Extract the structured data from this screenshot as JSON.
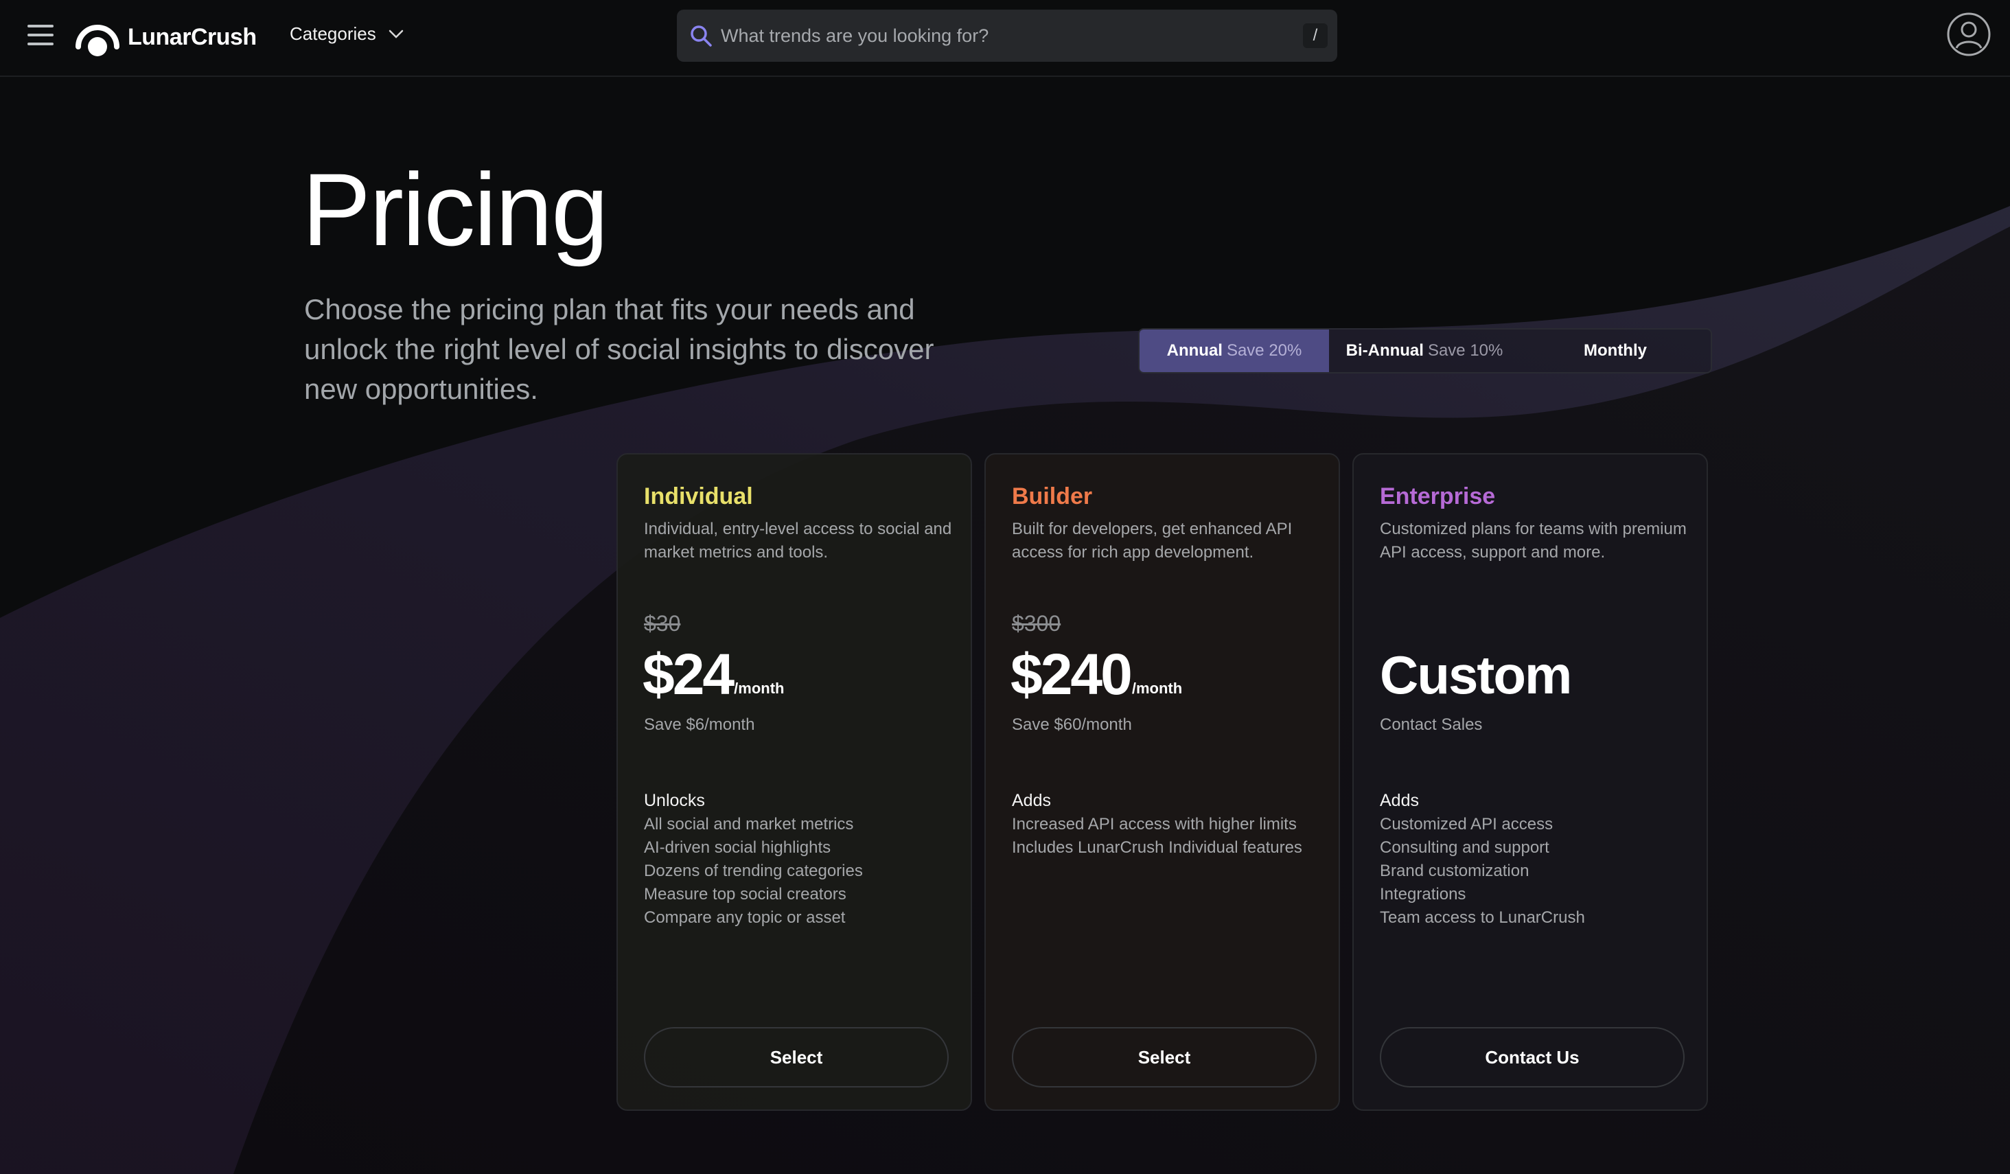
{
  "header": {
    "brand": "LunarCrush",
    "categories_label": "Categories",
    "search_placeholder": "What trends are you looking for?",
    "search_shortcut": "/"
  },
  "hero": {
    "title": "Pricing",
    "subtitle": "Choose the pricing plan that fits your needs and unlock the right level of social insights to discover new opportunities."
  },
  "billing": {
    "selected": "Annual",
    "options": [
      {
        "label": "Annual",
        "save": "Save 20%"
      },
      {
        "label": "Bi-Annual",
        "save": "Save 10%"
      },
      {
        "label": "Monthly",
        "save": ""
      }
    ]
  },
  "plans": [
    {
      "name": "Individual",
      "color": "#e8e06a",
      "description": "Individual, entry-level access to social and market metrics and tools.",
      "old_price": "$30",
      "price": "$24",
      "period": "/month",
      "note": "Save $6/month",
      "features_title": "Unlocks",
      "features": [
        "All social and market metrics",
        "AI-driven social highlights",
        "Dozens of trending categories",
        "Measure top social creators",
        "Compare any topic or asset"
      ],
      "button": "Select"
    },
    {
      "name": "Builder",
      "color": "#ef7a4a",
      "description": "Built for developers, get enhanced API access for rich app development.",
      "old_price": "$300",
      "price": "$240",
      "period": "/month",
      "note": "Save $60/month",
      "features_title": "Adds",
      "features": [
        "Increased API access with higher limits",
        "Includes LunarCrush Individual features"
      ],
      "button": "Select"
    },
    {
      "name": "Enterprise",
      "color": "#b66ad6",
      "description": "Customized plans for teams with premium API access, support and more.",
      "price": "Custom",
      "note": "Contact Sales",
      "features_title": "Adds",
      "features": [
        "Customized API access",
        "Consulting and support",
        "Brand customization",
        "Integrations",
        "Team access to LunarCrush"
      ],
      "button": "Contact Us"
    }
  ]
}
